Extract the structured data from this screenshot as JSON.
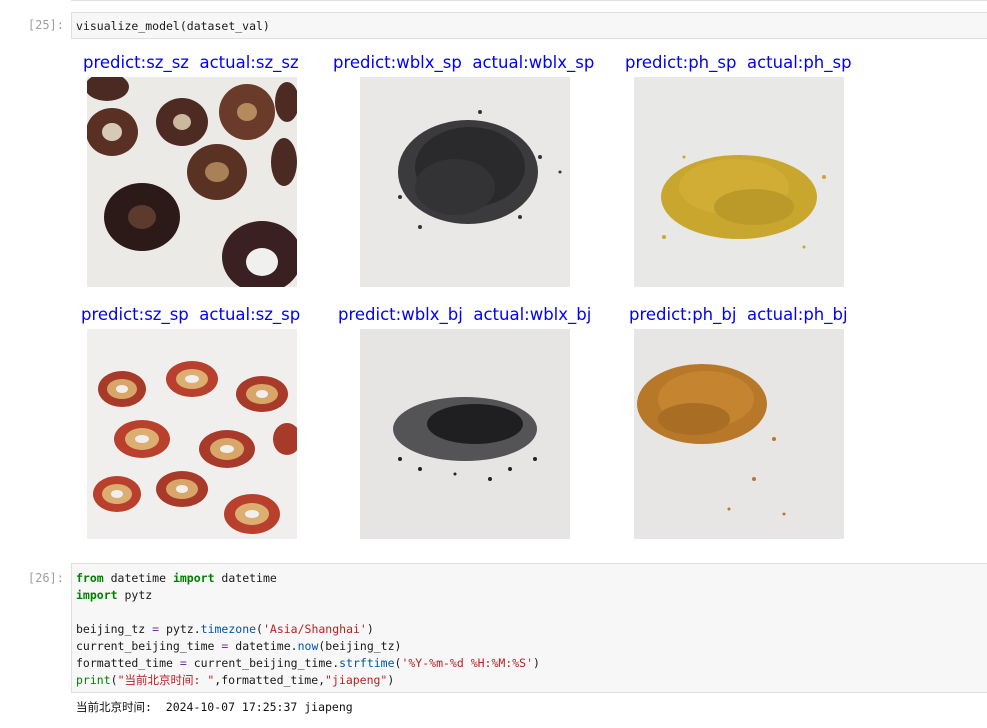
{
  "cell25": {
    "prompt": "[25]:",
    "code": "visualize_model(dataset_val)"
  },
  "tiles": [
    {
      "predict": "predict:sz_sz",
      "actual": "actual:sz_sz"
    },
    {
      "predict": "predict:wblx_sp",
      "actual": "actual:wblx_sp"
    },
    {
      "predict": "predict:ph_sp",
      "actual": "actual:ph_sp"
    },
    {
      "predict": "predict:sz_sp",
      "actual": "actual:sz_sp"
    },
    {
      "predict": "predict:wblx_bj",
      "actual": "actual:wblx_bj"
    },
    {
      "predict": "predict:ph_bj",
      "actual": "actual:ph_bj"
    }
  ],
  "cell26": {
    "prompt": "[26]:",
    "line1": {
      "kw1": "from",
      "mod": " datetime ",
      "kw2": "import",
      "name": " datetime"
    },
    "line2": {
      "kw": "import",
      "name": " pytz"
    },
    "line4": {
      "a": "beijing_tz ",
      "eq": "=",
      "b": " pytz.",
      "fn": "timezone",
      "c": "(",
      "s": "'Asia/Shanghai'",
      "d": ")"
    },
    "line5": {
      "a": "current_beijing_time ",
      "eq": "=",
      "b": " datetime.",
      "fn": "now",
      "c": "(beijing_tz)"
    },
    "line6": {
      "a": "formatted_time ",
      "eq": "=",
      "b": " current_beijing_time.",
      "fn": "strftime",
      "c": "(",
      "s": "'%Y-%m-%d %H:%M:%S'",
      "d": ")"
    },
    "line7": {
      "fn": "print",
      "c": "(",
      "s1": "\"当前北京时间: \"",
      "m": ",formatted_time,",
      "s2": "\"jiapeng\"",
      "d": ")"
    }
  },
  "output": "当前北京时间:  2024-10-07 17:25:37 jiapeng",
  "colors": {
    "title_blue": "#0000ff",
    "keyword_green": "#008000",
    "string_red": "#ba2121"
  }
}
